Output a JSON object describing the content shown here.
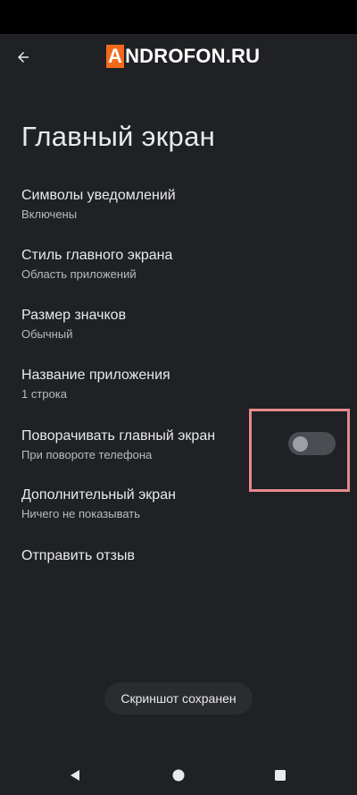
{
  "header": {
    "back_icon": "arrow-back-icon",
    "watermark_first": "A",
    "watermark_rest": "NDROFON.RU"
  },
  "page": {
    "title": "Главный экран"
  },
  "settings": [
    {
      "title": "Символы уведомлений",
      "summary": "Включены"
    },
    {
      "title": "Стиль главного экрана",
      "summary": "Область приложений"
    },
    {
      "title": "Размер значков",
      "summary": "Обычный"
    },
    {
      "title": "Название приложения",
      "summary": "1 строка"
    },
    {
      "title": "Поворачивать главный экран",
      "summary": "При повороте телефона",
      "toggle": false
    },
    {
      "title": "Дополнительный экран",
      "summary": "Ничего не показывать"
    },
    {
      "title": "Отправить отзыв"
    }
  ],
  "toast": {
    "text": "Скриншот сохранен"
  },
  "nav": {
    "back_icon": "triangle-back-icon",
    "home_icon": "circle-home-icon",
    "recents_icon": "square-recents-icon"
  },
  "colors": {
    "background": "#202124",
    "status_bar": "#000000",
    "watermark_accent": "#f26a1b",
    "highlight": "#e5898b",
    "toggle_track": "#4a4d52"
  }
}
